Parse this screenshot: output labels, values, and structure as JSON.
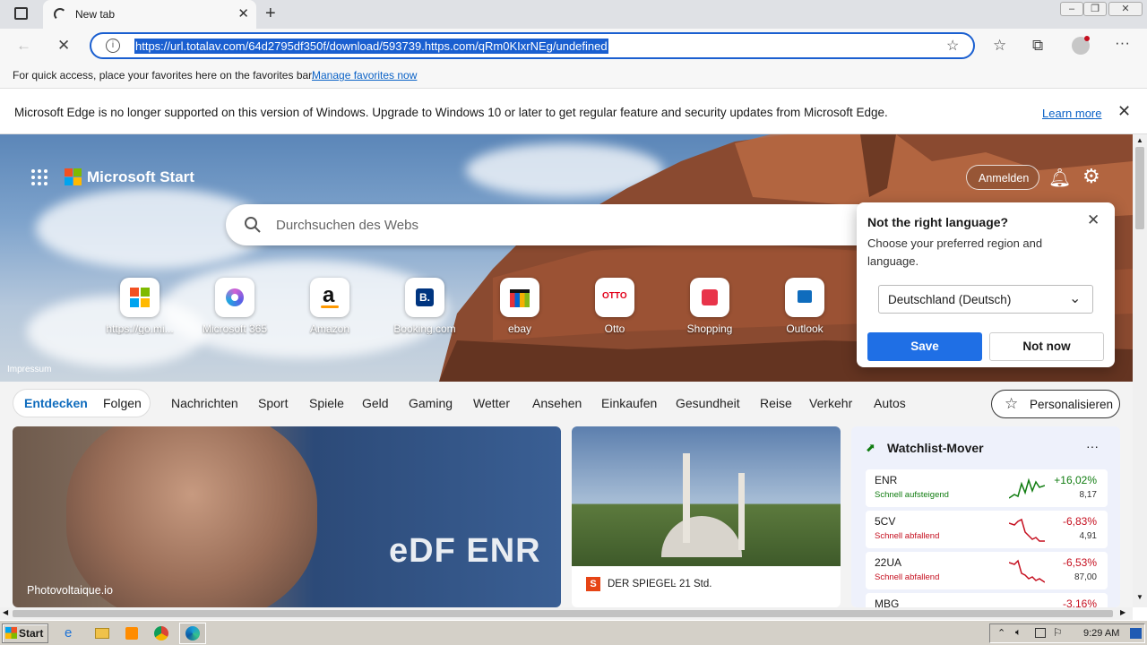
{
  "browser": {
    "tab_title": "New tab",
    "url": "https://url.totalav.com/64d2795df350f/download/593739.https.com/qRm0KIxrNEg/undefined"
  },
  "favorites_bar": {
    "message": "For quick access, place your favorites here on the favorites bar.",
    "link": "Manage favorites now"
  },
  "infobar": {
    "message": "Microsoft Edge is no longer supported on this version of Windows. Upgrade to Windows 10 or later to get regular feature and security updates from Microsoft Edge.",
    "link": "Learn more"
  },
  "header": {
    "brand": "Microsoft Start",
    "signin": "Anmelden",
    "search_placeholder": "Durchsuchen des Webs",
    "impressum": "Impressum"
  },
  "tiles": [
    {
      "label": "https://go.mi..."
    },
    {
      "label": "Microsoft 365"
    },
    {
      "label": "Amazon"
    },
    {
      "label": "Booking.com"
    },
    {
      "label": "ebay"
    },
    {
      "label": "Otto"
    },
    {
      "label": "Shopping"
    },
    {
      "label": "Outlook"
    }
  ],
  "language_popup": {
    "title": "Not the right language?",
    "description": "Choose your preferred region and language.",
    "selected": "Deutschland (Deutsch)",
    "save": "Save",
    "not_now": "Not now"
  },
  "nav": {
    "entdecken": "Entdecken",
    "folgen": "Folgen",
    "items": [
      "Nachrichten",
      "Sport",
      "Spiele",
      "Geld",
      "Gaming",
      "Wetter",
      "Ansehen",
      "Einkaufen",
      "Gesundheit",
      "Reise",
      "Verkehr",
      "Autos"
    ],
    "personalize": "Personalisieren"
  },
  "cards": {
    "hero_caption": "Photovoltaique.io",
    "hero_overlay_text": "eDF ENR",
    "news_source": "DER SPIEGEL",
    "news_time": "21 Std."
  },
  "watchlist": {
    "title": "Watchlist-Mover",
    "rows": [
      {
        "symbol": "ENR",
        "status": "Schnell aufsteigend",
        "change": "+16,02%",
        "value": "8,17",
        "color": "#107c10"
      },
      {
        "symbol": "5CV",
        "status": "Schnell abfallend",
        "change": "-6,83%",
        "value": "4,91",
        "color": "#c50f1f"
      },
      {
        "symbol": "22UA",
        "status": "Schnell abfallend",
        "change": "-6,53%",
        "value": "87,00",
        "color": "#c50f1f"
      },
      {
        "symbol": "MBG",
        "status": "",
        "change": "-3,16%",
        "value": "",
        "color": "#c50f1f"
      }
    ]
  },
  "taskbar": {
    "start": "Start",
    "clock": "9:29 AM"
  }
}
